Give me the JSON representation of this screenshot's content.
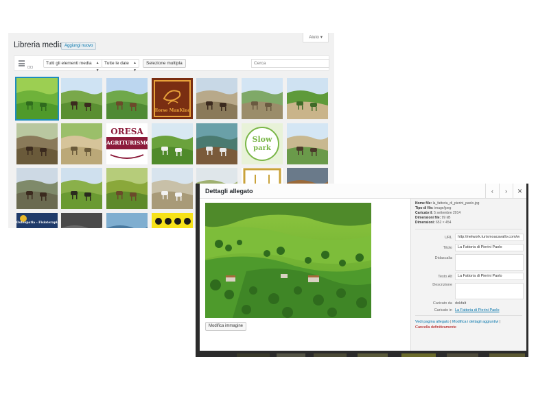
{
  "library": {
    "title": "Libreria media",
    "add_new_label": "Aggiungi nuovo",
    "screen_options_label": "Aiuto",
    "filters": {
      "type_selected": "Tutti gli elementi media",
      "date_selected": "Tutte le date",
      "bulk_select_label": "Selezione multipla",
      "search_placeholder": "Cerca"
    },
    "thumbnails": [
      {
        "theme": "meadow",
        "selected": true
      },
      {
        "theme": "riders-field"
      },
      {
        "theme": "horse-hill"
      },
      {
        "theme": "logo-horsemankind",
        "text": "Horse ManKind"
      },
      {
        "theme": "riders-road"
      },
      {
        "theme": "landscape-fence"
      },
      {
        "theme": "arena-trees"
      },
      {
        "theme": "horses-fence"
      },
      {
        "theme": "arena-sand"
      },
      {
        "theme": "logo-oresaagriturismo",
        "text_top": "ORESA",
        "text_bottom": "AGRITURISMO"
      },
      {
        "theme": "horses-grazing"
      },
      {
        "theme": "horse-water"
      },
      {
        "theme": "logo-slowpark",
        "text_top": "Slow",
        "text_bottom": "park"
      },
      {
        "theme": "arena-jump"
      },
      {
        "theme": "riders-forest"
      },
      {
        "theme": "riders-group"
      },
      {
        "theme": "horses-hill"
      },
      {
        "theme": "horse-beach"
      },
      {
        "theme": "horse-field-grey"
      },
      {
        "theme": "logo-gold"
      },
      {
        "theme": "rider-autumn"
      },
      {
        "theme": "logo-osteopatia",
        "text": "Osteopatia - Fisioterapia"
      },
      {
        "theme": "dark-stable"
      },
      {
        "theme": "riders-coast"
      },
      {
        "theme": "logo-yellow-horses"
      }
    ]
  },
  "modal": {
    "title": "Dettagli allegato",
    "prev_icon": "chevron-left-icon",
    "next_icon": "chevron-right-icon",
    "close_icon": "close-icon",
    "edit_image_label": "Modifica immagine",
    "meta": {
      "file_name_label": "Nome file:",
      "file_name": "la_fattoria_di_pierini_paolo.jpg",
      "file_type_label": "Tipo di file:",
      "file_type": "image/jpeg",
      "uploaded_label": "Caricato il:",
      "uploaded": "5 settembre 2014",
      "file_size_label": "Dimensioni file:",
      "file_size": "99 kB",
      "dimensions_label": "Dimensioni:",
      "dimensions": "652 × 454"
    },
    "fields": {
      "url_label": "URL",
      "url_value": "http://network.turismoacavallo.com/w",
      "title_label": "Titolo",
      "title_value": "La Fattoria di Pierini Paolo",
      "caption_label": "Didascalia",
      "caption_value": "",
      "alt_label": "Testo Alt",
      "alt_value": "La Fattoria di Pierini Paolo",
      "description_label": "Descrizione",
      "description_value": "",
      "uploaded_by_label": "Caricato da",
      "uploaded_by_value": "dokfalt",
      "uploaded_to_label": "Caricato in",
      "uploaded_to_value": "La Fattoria di Pierini Paolo"
    },
    "actions": {
      "view_page": "Vedi pagina allegato",
      "edit_more": "Modifica i dettagli aggiuntivi",
      "delete": "Cancella definitivamente",
      "separator": "|"
    }
  },
  "colors": {
    "accent": "#0073aa",
    "selected_outline": "#1e8cbe",
    "delete": "#aa0000"
  }
}
